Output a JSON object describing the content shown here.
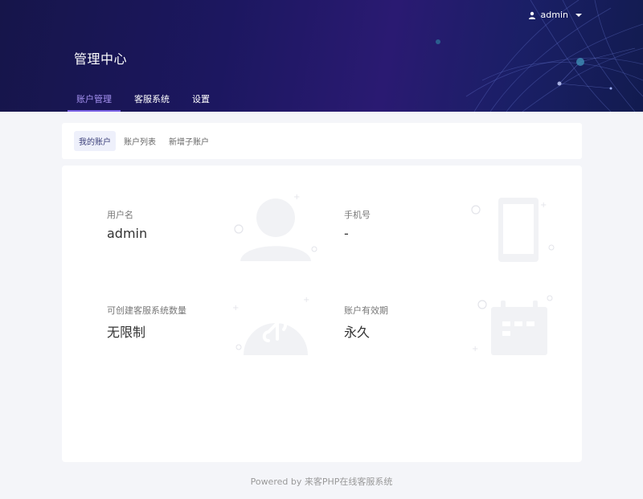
{
  "header": {
    "user_name": "admin",
    "page_title": "管理中心",
    "nav": [
      {
        "label": "账户管理",
        "active": true
      },
      {
        "label": "客服系统",
        "active": false
      },
      {
        "label": "设置",
        "active": false
      }
    ]
  },
  "subtabs": [
    {
      "label": "我的账户",
      "active": true
    },
    {
      "label": "账户列表",
      "active": false
    },
    {
      "label": "新增子账户",
      "active": false
    }
  ],
  "account": {
    "username_label": "用户名",
    "username_value": "admin",
    "phone_label": "手机号",
    "phone_value": "-",
    "quota_label": "可创建客服系统数量",
    "quota_value": "无限制",
    "expiry_label": "账户有效期",
    "expiry_value": "永久"
  },
  "icons": {
    "username": "user-icon",
    "phone": "mobile-phone-icon",
    "quota": "mini-program-icon",
    "expiry": "calendar-icon",
    "user_menu": "person-icon"
  },
  "colors": {
    "accent": "#7b63e6",
    "banner": "#1c1760"
  },
  "footer": {
    "text": "Powered by 来客PHP在线客服系统"
  }
}
